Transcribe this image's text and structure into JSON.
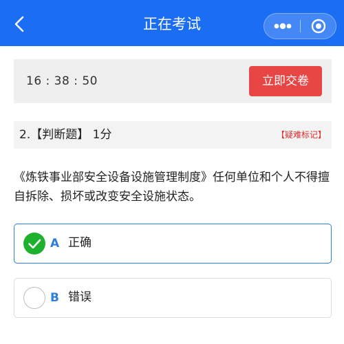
{
  "nav": {
    "title": "正在考试",
    "back_icon": "chevron-left-icon",
    "more_icon": "more-dots-icon",
    "close_icon": "target-circle-icon",
    "background_color": "#1b6ef3"
  },
  "timer": {
    "time": "16 : 38 : 50",
    "submit_label": "立即交卷",
    "submit_color": "#e84545"
  },
  "question": {
    "number": "2.",
    "type": "【判断题】",
    "score": "1分",
    "mark_label": "【疑难标记】",
    "text": "《炼铁事业部安全设备设施管理制度》任何单位和个人不得擅自拆除、损坏或改变安全设施状态。"
  },
  "options": [
    {
      "letter": "A",
      "text": "正确",
      "selected": true,
      "check_icon": "checkmark-icon"
    },
    {
      "letter": "B",
      "text": "错误",
      "selected": false
    }
  ],
  "colors": {
    "accent": "#2f7de1",
    "selected_check": "#1eb12e",
    "mark": "#e02e2e"
  }
}
